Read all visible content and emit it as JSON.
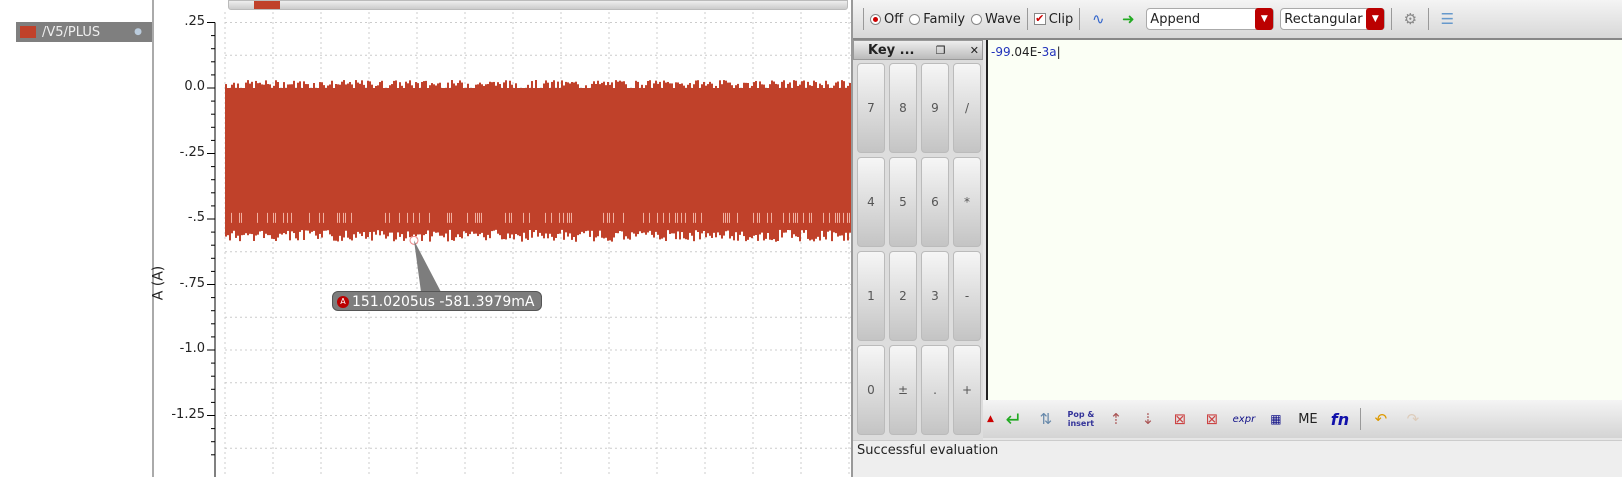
{
  "legend": {
    "signal": "/V5/PLUS",
    "color": "#c0412a"
  },
  "plot": {
    "ylabel": "A (A)",
    "yticks": [
      ".25",
      "0.0",
      "-.25",
      "-.5",
      "-.75",
      "-1.0",
      "-1.25"
    ],
    "marker_label": "A",
    "marker_text": "151.0205us -581.3979mA",
    "trace_top": 0.0,
    "trace_bottom": -0.53,
    "trace_min": -0.5814
  },
  "toolbar": {
    "off": "Off",
    "family": "Family",
    "wave": "Wave",
    "clip": "Clip",
    "mode": "Append",
    "shape": "Rectangular"
  },
  "keypad": {
    "title": "Key ...",
    "keys": [
      "7",
      "8",
      "9",
      "/",
      "4",
      "5",
      "6",
      "*",
      "1",
      "2",
      "3",
      "-",
      "0",
      "±",
      ".",
      "+"
    ]
  },
  "editor": {
    "value_a": "-99",
    "value_b": ".04E-",
    "value_c": "3a"
  },
  "bottom_toolbar": {
    "pop_insert": "Pop & insert",
    "expr": "expr",
    "me": "ME",
    "fn": "fn"
  },
  "status": "Successful evaluation"
}
